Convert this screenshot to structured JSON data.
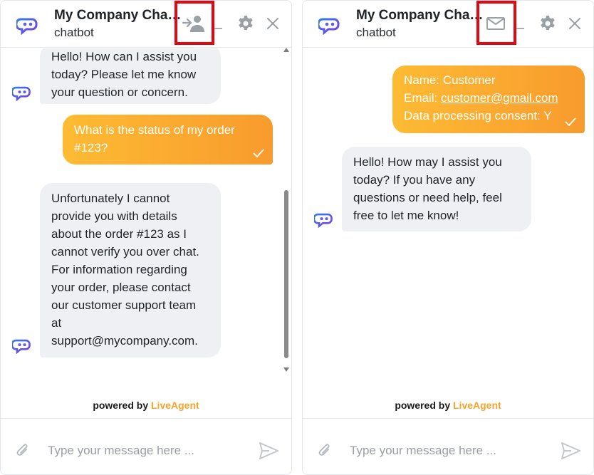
{
  "left_panel": {
    "title": "My Company Chat...",
    "subtitle": "chatbot",
    "header_action_icon": "add-user-icon",
    "messages": [
      {
        "type": "bot",
        "lines": [
          "Hello! How can I assist you",
          "today? Please let me know",
          "your question or concern."
        ]
      },
      {
        "type": "user",
        "lines": [
          "What is the status of my order",
          "#123?"
        ]
      },
      {
        "type": "bot",
        "lines": [
          "Unfortunately I cannot",
          "provide you with details",
          "about the order #123 as I",
          "cannot verify you over chat.",
          "For information regarding",
          "your order, please contact",
          "our customer support team",
          "at",
          "support@mycompany.com."
        ]
      }
    ]
  },
  "right_panel": {
    "title": "My Company Chat...",
    "subtitle": "chatbot",
    "header_action_icon": "email-icon",
    "user_message": {
      "name_line": "Name: Customer",
      "email_label": "Email: ",
      "email_value": "customer@gmail.com",
      "consent_line": "Data processing consent: Y"
    },
    "bot_message": {
      "lines": [
        "Hello! How may I assist you",
        "today? If you have any",
        "questions or need help, feel",
        "free to let me know!"
      ]
    }
  },
  "powered": {
    "prefix": "powered by",
    "brand": "LiveAgent"
  },
  "composer": {
    "placeholder": "Type your message here ..."
  },
  "colors": {
    "accent_orange": "#f89b2e",
    "accent_yellow": "#fdbb33",
    "highlight_red": "#e30613",
    "logo_blue": "#2f7bf0",
    "logo_purple": "#7b3fe4",
    "bot_bubble": "#eff0f3",
    "brand": "#f7a42c"
  }
}
